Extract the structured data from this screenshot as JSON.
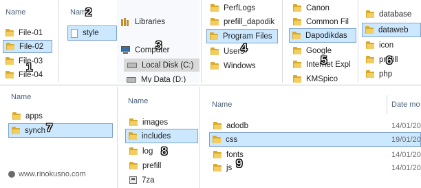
{
  "panel1": {
    "header": "Name",
    "items": [
      "File-01",
      "File-02",
      "File-03",
      "File-04"
    ],
    "selected": 1
  },
  "panel2": {
    "header": "Name",
    "items": [
      "style"
    ]
  },
  "panel3": {
    "items": [
      "Libraries",
      "Computer",
      "Local Disk (C:)",
      "My Data (D:)"
    ]
  },
  "panel4": {
    "items": [
      "PerfLogs",
      "prefill_dapodik",
      "Program Files",
      "Users",
      "Windows"
    ]
  },
  "panel5": {
    "items": [
      "Canon",
      "Common Fil",
      "Dapodikdas",
      "Google",
      "Internet Expl",
      "KMSpico"
    ]
  },
  "panel6": {
    "items": [
      "database",
      "dataweb",
      "icon",
      "prefill",
      "php"
    ]
  },
  "bottom1": {
    "header": "Name",
    "items": [
      "apps",
      "synch"
    ]
  },
  "bottom2": {
    "header": "Name",
    "items": [
      "images",
      "includes",
      "log",
      "prefill",
      "7za"
    ]
  },
  "bottom3": {
    "name_header": "Name",
    "date_header": "Date mo",
    "items": [
      "adodb",
      "css",
      "fonts",
      "js"
    ],
    "dates": [
      "14/01/20",
      "19/01/20",
      "14/01/20",
      "14/01/20"
    ]
  },
  "step_numbers": [
    "1",
    "2",
    "3",
    "4",
    "5",
    "6",
    "7",
    "8",
    "9"
  ],
  "watermark": "www.rinokusno.com",
  "colors": {
    "selection": "#cce8ff",
    "selection_border": "#7da2ce",
    "folder": "#f2cd5f",
    "header_text": "#4c607a"
  }
}
